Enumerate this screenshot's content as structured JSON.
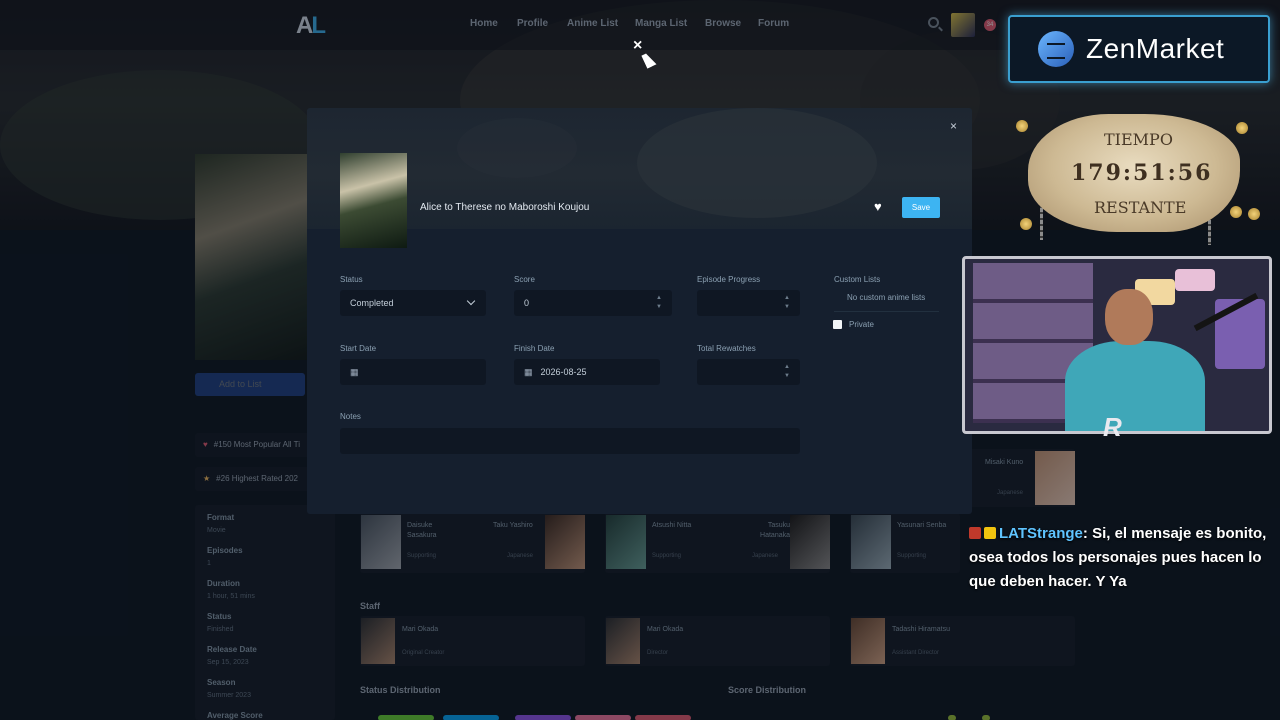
{
  "nav": {
    "logo_a": "A",
    "logo_l": "L",
    "links": [
      "Home",
      "Profile",
      "Anime List",
      "Manga List",
      "Browse",
      "Forum"
    ],
    "badge": "34"
  },
  "sidebar": {
    "add_button": "Add to List",
    "rank_popular": "#150 Most Popular All Ti",
    "rank_rated": "#26 Highest Rated 202",
    "fields": [
      {
        "label": "Format",
        "value": "Movie"
      },
      {
        "label": "Episodes",
        "value": "1"
      },
      {
        "label": "Duration",
        "value": "1 hour, 51 mins"
      },
      {
        "label": "Status",
        "value": "Finished"
      },
      {
        "label": "Release Date",
        "value": "Sep 15, 2023"
      },
      {
        "label": "Season",
        "value": "Summer 2023"
      },
      {
        "label": "Average Score",
        "value": ""
      }
    ]
  },
  "characters": {
    "top_va_name": "Misaki Kuno",
    "top_va_role": "Japanese",
    "rows": [
      {
        "char": "Daisuke Sasakura",
        "char_role": "Supporting",
        "va": "Taku Yashiro",
        "va_role": "Japanese"
      },
      {
        "char": "Atsushi Nitta",
        "char_role": "Supporting",
        "va": "Tasuku Hatanaka",
        "va_role": "Japanese"
      },
      {
        "char": "Yasunari Senba",
        "char_role": "Supporting",
        "va": "",
        "va_role": ""
      }
    ]
  },
  "staff": {
    "title": "Staff",
    "items": [
      {
        "name": "Mari Okada",
        "role": "Original Creator"
      },
      {
        "name": "Mari Okada",
        "role": "Director"
      },
      {
        "name": "Tadashi Hiramatsu",
        "role": "Assistant Director"
      }
    ]
  },
  "distribution": {
    "status_title": "Status Distribution",
    "score_title": "Score Distribution",
    "colors": [
      "#68d639",
      "#02a9ff",
      "#9256f3",
      "#f779a4",
      "#e85d75"
    ]
  },
  "modal": {
    "close_icon": "×",
    "title": "Alice to Therese no Maboroshi Koujou",
    "save_label": "Save",
    "status_label": "Status",
    "status_value": "Completed",
    "score_label": "Score",
    "score_value": "0",
    "progress_label": "Episode Progress",
    "progress_value": "",
    "custom_lists_label": "Custom Lists",
    "custom_lists_empty": "No custom anime lists",
    "private_label": "Private",
    "start_label": "Start Date",
    "start_value": "",
    "finish_label": "Finish Date",
    "finish_value": "2026-08-25",
    "rewatches_label": "Total Rewatches",
    "rewatches_value": "",
    "notes_label": "Notes",
    "notes_value": ""
  },
  "overlay": {
    "brand": "ZenMarket",
    "timer_top": "TIEMPO",
    "timer_value": "179:51:56",
    "timer_bottom": "RESTANTE",
    "cam_logo": "R",
    "chat_user": "LATStrange",
    "chat_message": ": Si, el mensaje es bonito, osea todos los personajes pues hacen lo que deben hacer. Y Ya"
  },
  "icons": {
    "close": "close-icon",
    "heart": "heart-icon",
    "search": "search-icon",
    "calendar": "calendar-icon",
    "chevron": "chevron-down-icon"
  },
  "accent": "#3db4f2"
}
